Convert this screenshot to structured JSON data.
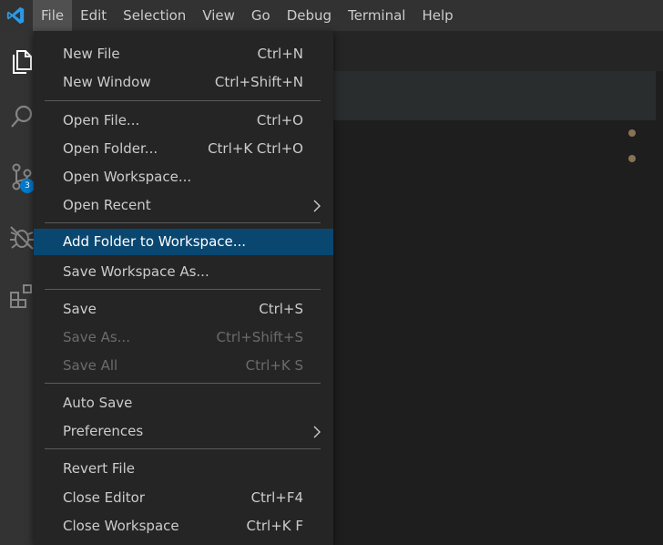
{
  "menubar": {
    "items": [
      "File",
      "Edit",
      "Selection",
      "View",
      "Go",
      "Debug",
      "Terminal",
      "Help"
    ],
    "active": "File"
  },
  "activitybar": {
    "icons": [
      "explorer-icon",
      "search-icon",
      "source-control-icon",
      "debug-icon",
      "extensions-icon"
    ],
    "source_control_badge": "3"
  },
  "file_menu": {
    "items": [
      {
        "label": "New File",
        "shortcut": "Ctrl+N"
      },
      {
        "label": "New Window",
        "shortcut": "Ctrl+Shift+N"
      },
      {
        "label": "Open File...",
        "shortcut": "Ctrl+O"
      },
      {
        "label": "Open Folder...",
        "shortcut": "Ctrl+K Ctrl+O"
      },
      {
        "label": "Open Workspace...",
        "shortcut": ""
      },
      {
        "label": "Open Recent",
        "shortcut": ""
      },
      {
        "label": "Add Folder to Workspace...",
        "shortcut": ""
      },
      {
        "label": "Save Workspace As...",
        "shortcut": ""
      },
      {
        "label": "Save",
        "shortcut": "Ctrl+S"
      },
      {
        "label": "Save As...",
        "shortcut": "Ctrl+Shift+S"
      },
      {
        "label": "Save All",
        "shortcut": "Ctrl+K S"
      },
      {
        "label": "Auto Save",
        "shortcut": ""
      },
      {
        "label": "Preferences",
        "shortcut": ""
      },
      {
        "label": "Revert File",
        "shortcut": ""
      },
      {
        "label": "Close Editor",
        "shortcut": "Ctrl+F4"
      },
      {
        "label": "Close Workspace",
        "shortcut": "Ctrl+K F"
      }
    ],
    "highlighted": "Add Folder to Workspace...",
    "disabled": [
      "Save As...",
      "Save All"
    ],
    "submenus": [
      "Open Recent",
      "Preferences"
    ]
  },
  "colors": {
    "menubar_bg": "#323233",
    "menu_bg": "#252526",
    "highlight_bg": "#094771",
    "badge_bg": "#007acc",
    "logo": "#2b9ae6"
  }
}
